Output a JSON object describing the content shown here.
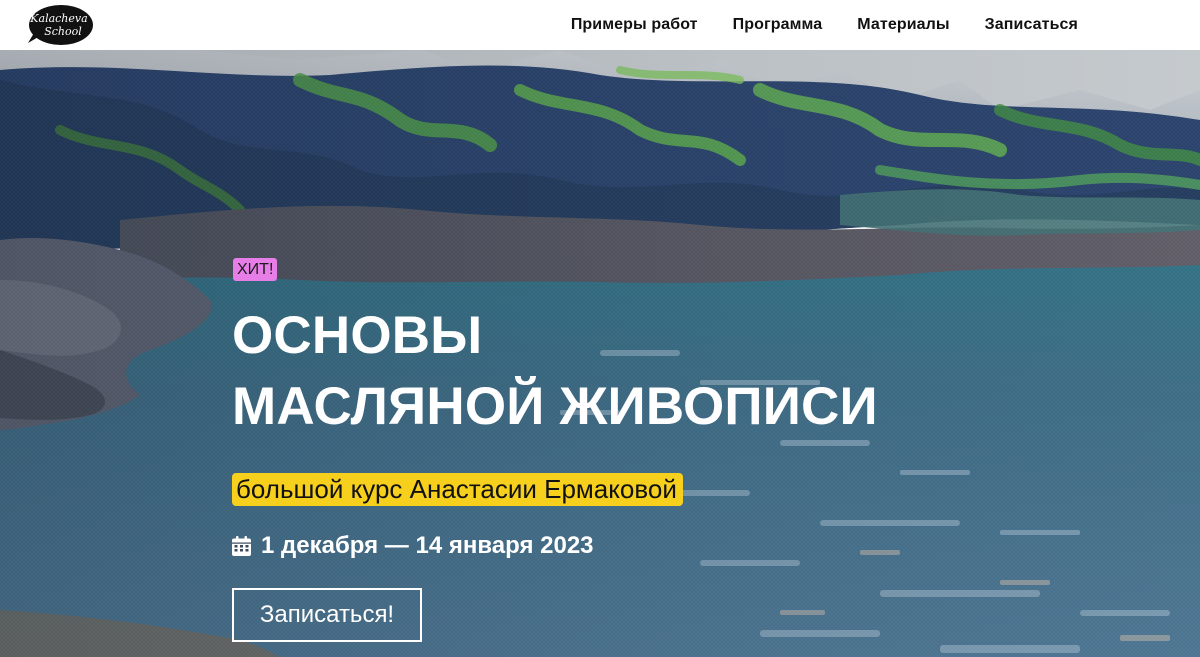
{
  "header": {
    "logo_line1": "Kalacheva",
    "logo_line2": "School",
    "nav": [
      {
        "label": "Примеры работ"
      },
      {
        "label": "Программа"
      },
      {
        "label": "Материалы"
      },
      {
        "label": "Записаться"
      }
    ]
  },
  "hero": {
    "badge": "ХИТ!",
    "title_line1": "ОСНОВЫ",
    "title_line2": "МАСЛЯНОЙ ЖИВОПИСИ",
    "subtitle": "большой курс Анастасии Ермаковой",
    "dates": "1 декабря — 14 января 2023",
    "cta_label": "Записаться!"
  },
  "colors": {
    "badge_bg": "#e77ee8",
    "subtitle_bg": "#f7cf1d",
    "nav_text": "#111111",
    "hero_text": "#ffffff"
  },
  "icons": {
    "dates": "calendar-icon"
  }
}
